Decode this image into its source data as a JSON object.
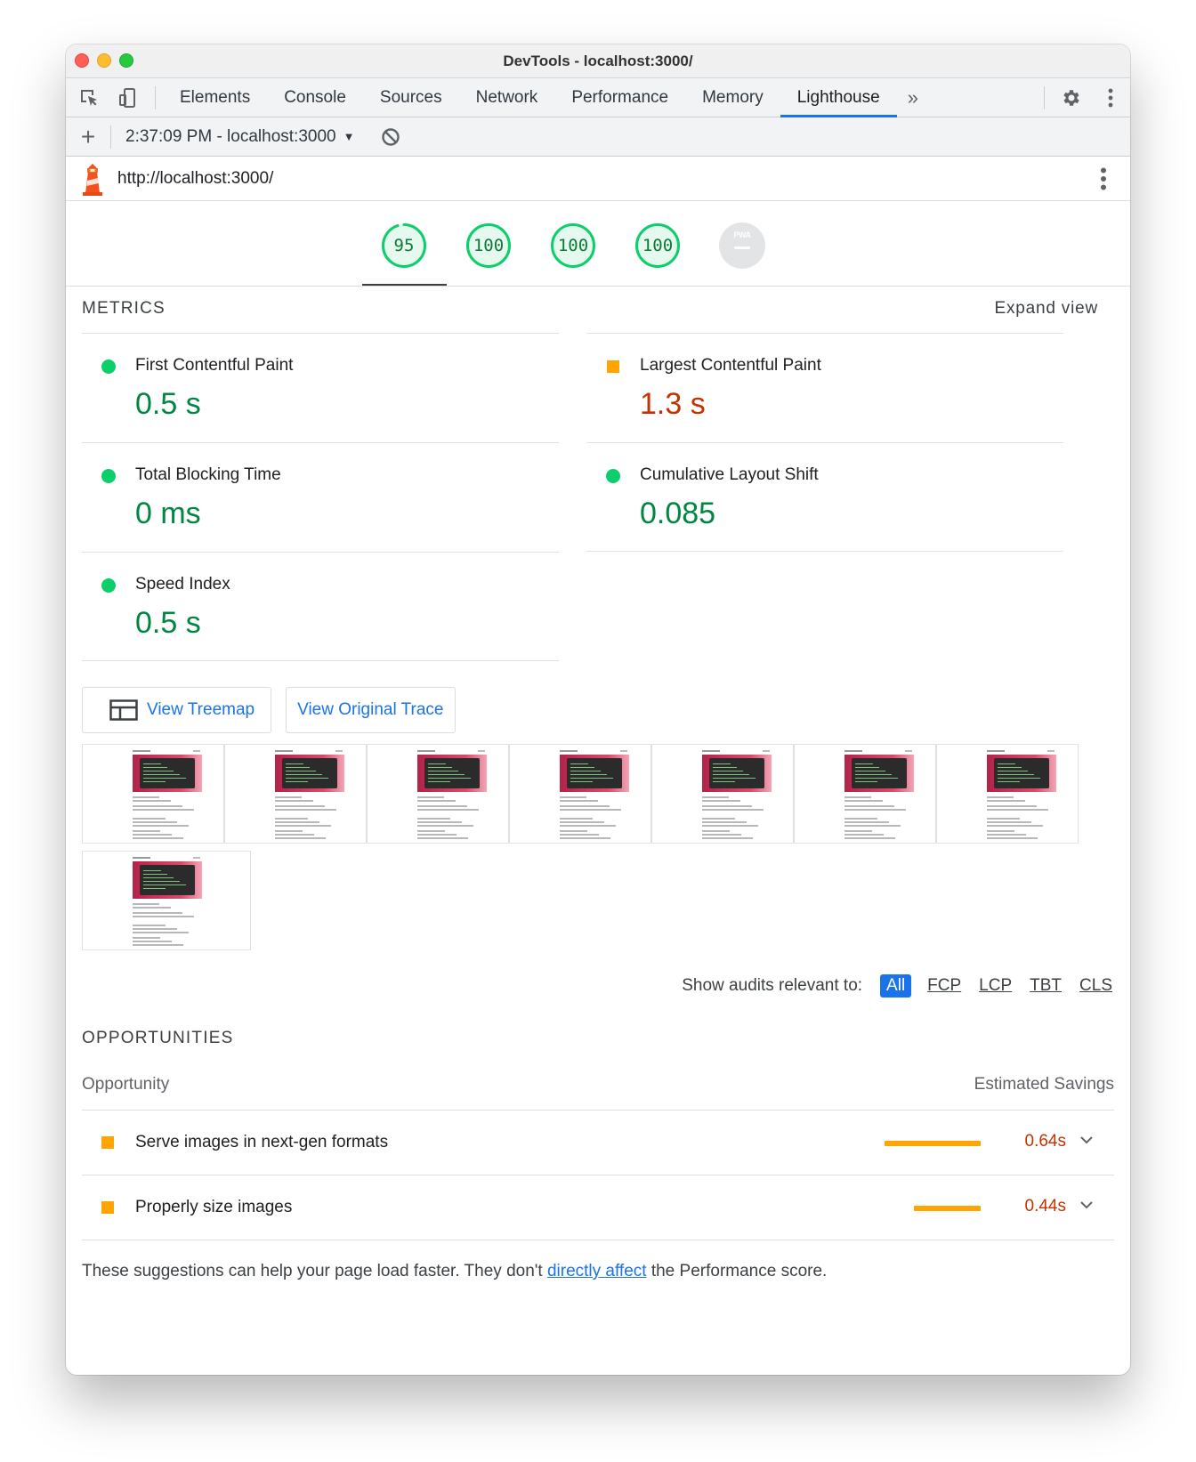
{
  "window": {
    "title": "DevTools - localhost:3000/"
  },
  "tabs": [
    {
      "label": "Elements"
    },
    {
      "label": "Console"
    },
    {
      "label": "Sources"
    },
    {
      "label": "Network"
    },
    {
      "label": "Performance"
    },
    {
      "label": "Memory"
    },
    {
      "label": "Lighthouse"
    }
  ],
  "active_tab": "Lighthouse",
  "more_tabs": "»",
  "report": {
    "selected": "2:37:09 PM - localhost:3000",
    "caret": "▼",
    "url": "http://localhost:3000/"
  },
  "scores": [
    {
      "value": "95",
      "fraction": 0.95
    },
    {
      "value": "100",
      "fraction": 1.0
    },
    {
      "value": "100",
      "fraction": 1.0
    },
    {
      "value": "100",
      "fraction": 1.0
    }
  ],
  "pwa": {
    "label": "PWA"
  },
  "metrics": {
    "section_title": "METRICS",
    "expand": "Expand view",
    "items": [
      {
        "name": "First Contentful Paint",
        "value": "0.5 s",
        "status": "pass"
      },
      {
        "name": "Largest Contentful Paint",
        "value": "1.3 s",
        "status": "average"
      },
      {
        "name": "Total Blocking Time",
        "value": "0 ms",
        "status": "pass"
      },
      {
        "name": "Cumulative Layout Shift",
        "value": "0.085",
        "status": "pass"
      },
      {
        "name": "Speed Index",
        "value": "0.5 s",
        "status": "pass"
      }
    ]
  },
  "buttons": {
    "treemap": "View Treemap",
    "trace": "View Original Trace"
  },
  "filmstrip": {
    "frame_count": 8
  },
  "filter": {
    "label": "Show audits relevant to:",
    "options": [
      "All",
      "FCP",
      "LCP",
      "TBT",
      "CLS"
    ],
    "active": "All"
  },
  "opportunities": {
    "section_title": "OPPORTUNITIES",
    "col_left": "Opportunity",
    "col_right": "Estimated Savings",
    "items": [
      {
        "title": "Serve images in next-gen formats",
        "savings": "0.64s",
        "bar_fraction": 1.0
      },
      {
        "title": "Properly size images",
        "savings": "0.44s",
        "bar_fraction": 0.69
      }
    ],
    "note_before": "These suggestions can help your page load faster. They don't ",
    "note_link": "directly affect",
    "note_after": " the Performance score."
  },
  "colors": {
    "pass": "#0cce6b",
    "average": "#ffa400",
    "good_text": "#018642",
    "warn_text": "#c33300",
    "link": "#1a73e8"
  }
}
